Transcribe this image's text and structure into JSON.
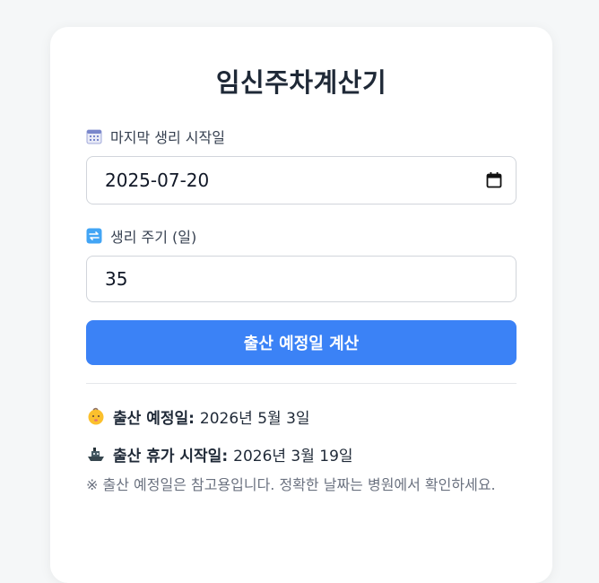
{
  "title": "임신주차계산기",
  "form": {
    "date_label": "마지막 생리 시작일",
    "date_icon": "calendar-icon",
    "date_value": "2025-07-20",
    "cycle_label": "생리 주기 (일)",
    "cycle_icon": "repeat-icon",
    "cycle_value": "35",
    "submit_label": "출산 예정일 계산"
  },
  "results": {
    "due_icon": "baby-icon",
    "due_label": "출산 예정일:",
    "due_value": "2026년 5월 3일",
    "leave_icon": "ship-icon",
    "leave_label": "출산 휴가 시작일:",
    "leave_value": "2026년 3월 19일",
    "note": "※ 출산 예정일은 참고용입니다. 정확한 날짜는 병원에서 확인하세요."
  },
  "colors": {
    "accent": "#3b82f6",
    "title": "#1f2937",
    "note": "#6b7280",
    "background": "#f5f7f8"
  }
}
